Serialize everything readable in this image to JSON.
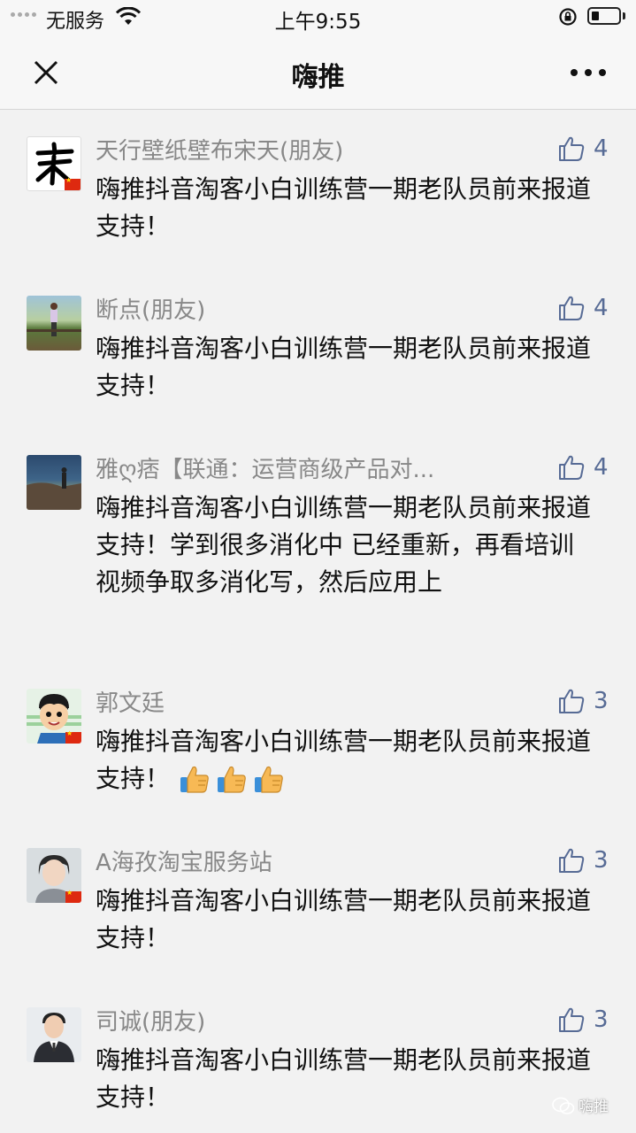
{
  "status_bar": {
    "carrier": "无服务",
    "time": "上午9:55",
    "battery_level": 0.3
  },
  "nav": {
    "title": "嗨推",
    "close_icon": "close-icon",
    "more_icon": "more-icon"
  },
  "comments": [
    {
      "nickname": "天行壁纸壁布宋天(朋友)",
      "text": "嗨推抖音淘客小白训练营一期老队员前来报道支持！",
      "likes": "4",
      "avatar": "song-calligraphy-avatar"
    },
    {
      "nickname": "断点(朋友)",
      "text": "嗨推抖音淘客小白训练营一期老队员前来报道支持！",
      "likes": "4",
      "avatar": "person-outdoor-avatar"
    },
    {
      "nickname": "雅ღ痞【联通：运营商级产品对...",
      "text": "嗨推抖音淘客小白训练营一期老队员前来报道支持！学到很多消化中 已经重新，再看培训视频争取多消化写，然后应用上",
      "likes": "4",
      "avatar": "seaside-avatar"
    },
    {
      "nickname": "郭文廷",
      "text": "嗨推抖音淘客小白训练营一期老队员前来报道支持！",
      "likes": "3",
      "avatar": "cartoon-boy-avatar",
      "thumbs_emoji_count": 3
    },
    {
      "nickname": "A海孜淘宝服务站",
      "text": "嗨推抖音淘客小白训练营一期老队员前来报道支持！",
      "likes": "3",
      "avatar": "portrait-woman-avatar"
    },
    {
      "nickname": "司诚(朋友)",
      "text": "嗨推抖音淘客小白训练营一期老队员前来报道支持！",
      "likes": "3",
      "avatar": "portrait-man-avatar"
    }
  ],
  "watermark": "嗨推",
  "colors": {
    "background": "#f2f2f2",
    "nickname": "#888888",
    "like_blue": "#576b95",
    "text": "#111111"
  }
}
